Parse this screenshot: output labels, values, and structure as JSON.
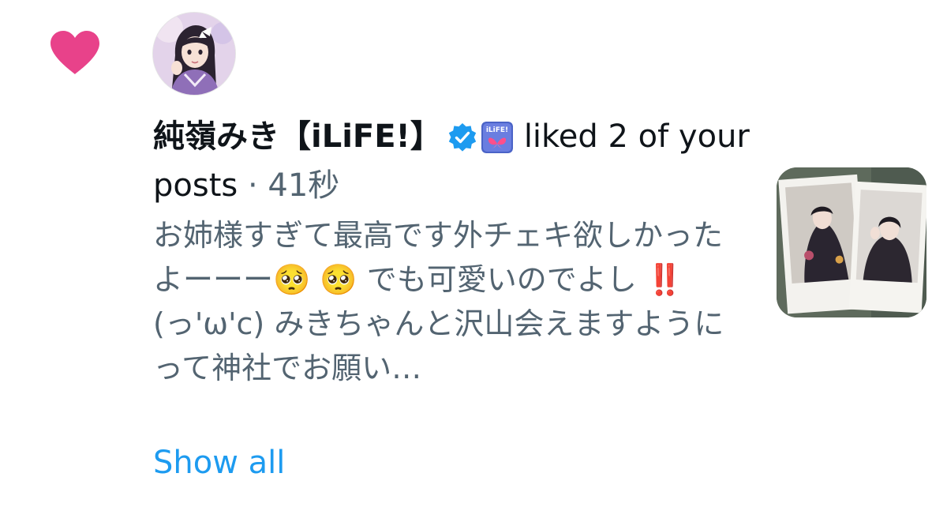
{
  "notification": {
    "type_icon": "heart-icon",
    "type_color": "#e8428a",
    "user": {
      "display_name": "純嶺みき【iLiFE!】",
      "verified_icon": "verified-badge-icon",
      "affiliate_badge_text": "iLiFE!"
    },
    "action_text": "liked 2 of your posts",
    "separator": "·",
    "timestamp": "41秒",
    "post_preview": "お姉様すぎて最高です外チェキ欲しかったよーーー🥺 🥺 でも可愛いのでよし ‼️ (っ'ω'c) みきちゃんと沢山会えますようにって神社でお願い…",
    "show_all_label": "Show all"
  },
  "colors": {
    "accent": "#1d9bf0",
    "heart": "#e8428a",
    "text_primary": "#0f1419",
    "text_secondary": "#536471"
  }
}
